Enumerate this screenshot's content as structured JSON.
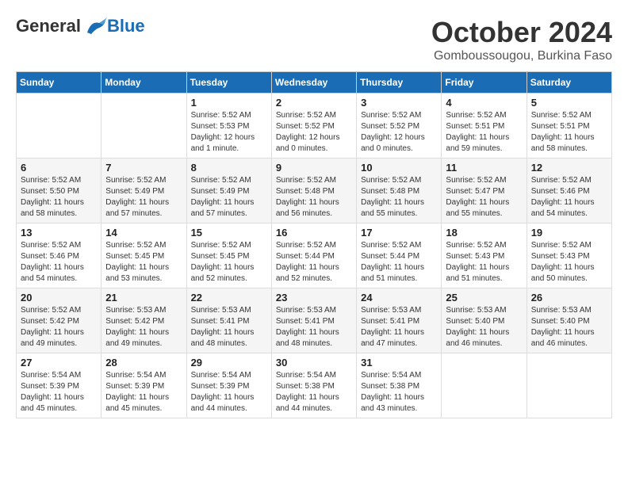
{
  "header": {
    "logo_general": "General",
    "logo_blue": "Blue",
    "month_title": "October 2024",
    "location": "Gomboussougou, Burkina Faso"
  },
  "calendar": {
    "days_of_week": [
      "Sunday",
      "Monday",
      "Tuesday",
      "Wednesday",
      "Thursday",
      "Friday",
      "Saturday"
    ],
    "weeks": [
      [
        {
          "day": "",
          "info": ""
        },
        {
          "day": "",
          "info": ""
        },
        {
          "day": "1",
          "info": "Sunrise: 5:52 AM\nSunset: 5:53 PM\nDaylight: 12 hours\nand 1 minute."
        },
        {
          "day": "2",
          "info": "Sunrise: 5:52 AM\nSunset: 5:52 PM\nDaylight: 12 hours\nand 0 minutes."
        },
        {
          "day": "3",
          "info": "Sunrise: 5:52 AM\nSunset: 5:52 PM\nDaylight: 12 hours\nand 0 minutes."
        },
        {
          "day": "4",
          "info": "Sunrise: 5:52 AM\nSunset: 5:51 PM\nDaylight: 11 hours\nand 59 minutes."
        },
        {
          "day": "5",
          "info": "Sunrise: 5:52 AM\nSunset: 5:51 PM\nDaylight: 11 hours\nand 58 minutes."
        }
      ],
      [
        {
          "day": "6",
          "info": "Sunrise: 5:52 AM\nSunset: 5:50 PM\nDaylight: 11 hours\nand 58 minutes."
        },
        {
          "day": "7",
          "info": "Sunrise: 5:52 AM\nSunset: 5:49 PM\nDaylight: 11 hours\nand 57 minutes."
        },
        {
          "day": "8",
          "info": "Sunrise: 5:52 AM\nSunset: 5:49 PM\nDaylight: 11 hours\nand 57 minutes."
        },
        {
          "day": "9",
          "info": "Sunrise: 5:52 AM\nSunset: 5:48 PM\nDaylight: 11 hours\nand 56 minutes."
        },
        {
          "day": "10",
          "info": "Sunrise: 5:52 AM\nSunset: 5:48 PM\nDaylight: 11 hours\nand 55 minutes."
        },
        {
          "day": "11",
          "info": "Sunrise: 5:52 AM\nSunset: 5:47 PM\nDaylight: 11 hours\nand 55 minutes."
        },
        {
          "day": "12",
          "info": "Sunrise: 5:52 AM\nSunset: 5:46 PM\nDaylight: 11 hours\nand 54 minutes."
        }
      ],
      [
        {
          "day": "13",
          "info": "Sunrise: 5:52 AM\nSunset: 5:46 PM\nDaylight: 11 hours\nand 54 minutes."
        },
        {
          "day": "14",
          "info": "Sunrise: 5:52 AM\nSunset: 5:45 PM\nDaylight: 11 hours\nand 53 minutes."
        },
        {
          "day": "15",
          "info": "Sunrise: 5:52 AM\nSunset: 5:45 PM\nDaylight: 11 hours\nand 52 minutes."
        },
        {
          "day": "16",
          "info": "Sunrise: 5:52 AM\nSunset: 5:44 PM\nDaylight: 11 hours\nand 52 minutes."
        },
        {
          "day": "17",
          "info": "Sunrise: 5:52 AM\nSunset: 5:44 PM\nDaylight: 11 hours\nand 51 minutes."
        },
        {
          "day": "18",
          "info": "Sunrise: 5:52 AM\nSunset: 5:43 PM\nDaylight: 11 hours\nand 51 minutes."
        },
        {
          "day": "19",
          "info": "Sunrise: 5:52 AM\nSunset: 5:43 PM\nDaylight: 11 hours\nand 50 minutes."
        }
      ],
      [
        {
          "day": "20",
          "info": "Sunrise: 5:52 AM\nSunset: 5:42 PM\nDaylight: 11 hours\nand 49 minutes."
        },
        {
          "day": "21",
          "info": "Sunrise: 5:53 AM\nSunset: 5:42 PM\nDaylight: 11 hours\nand 49 minutes."
        },
        {
          "day": "22",
          "info": "Sunrise: 5:53 AM\nSunset: 5:41 PM\nDaylight: 11 hours\nand 48 minutes."
        },
        {
          "day": "23",
          "info": "Sunrise: 5:53 AM\nSunset: 5:41 PM\nDaylight: 11 hours\nand 48 minutes."
        },
        {
          "day": "24",
          "info": "Sunrise: 5:53 AM\nSunset: 5:41 PM\nDaylight: 11 hours\nand 47 minutes."
        },
        {
          "day": "25",
          "info": "Sunrise: 5:53 AM\nSunset: 5:40 PM\nDaylight: 11 hours\nand 46 minutes."
        },
        {
          "day": "26",
          "info": "Sunrise: 5:53 AM\nSunset: 5:40 PM\nDaylight: 11 hours\nand 46 minutes."
        }
      ],
      [
        {
          "day": "27",
          "info": "Sunrise: 5:54 AM\nSunset: 5:39 PM\nDaylight: 11 hours\nand 45 minutes."
        },
        {
          "day": "28",
          "info": "Sunrise: 5:54 AM\nSunset: 5:39 PM\nDaylight: 11 hours\nand 45 minutes."
        },
        {
          "day": "29",
          "info": "Sunrise: 5:54 AM\nSunset: 5:39 PM\nDaylight: 11 hours\nand 44 minutes."
        },
        {
          "day": "30",
          "info": "Sunrise: 5:54 AM\nSunset: 5:38 PM\nDaylight: 11 hours\nand 44 minutes."
        },
        {
          "day": "31",
          "info": "Sunrise: 5:54 AM\nSunset: 5:38 PM\nDaylight: 11 hours\nand 43 minutes."
        },
        {
          "day": "",
          "info": ""
        },
        {
          "day": "",
          "info": ""
        }
      ]
    ]
  }
}
